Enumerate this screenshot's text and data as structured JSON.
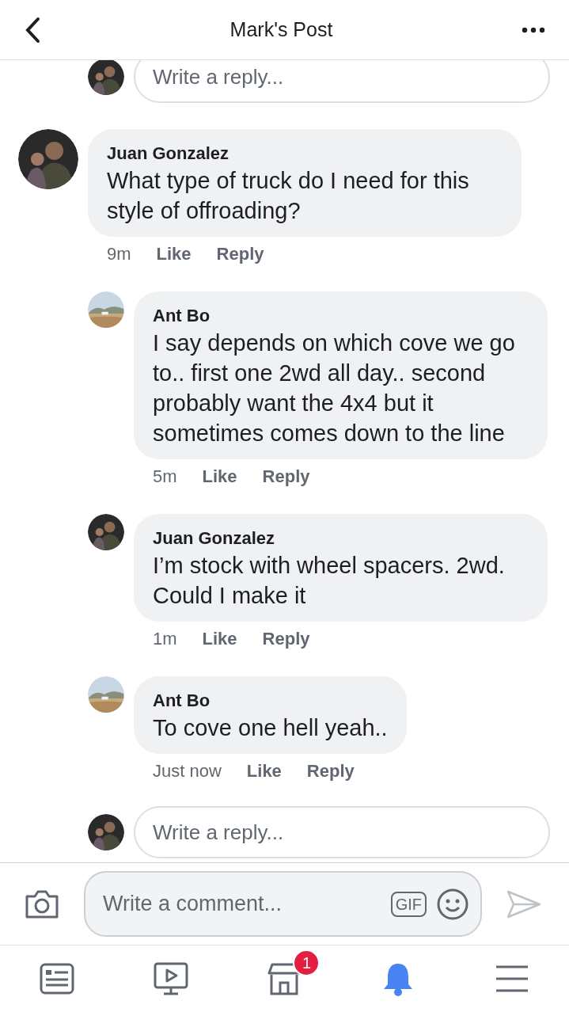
{
  "header": {
    "title": "Mark's Post"
  },
  "top_reply": {
    "placeholder": "Write a reply..."
  },
  "comments": [
    {
      "author": "Juan Gonzalez",
      "kind": "person",
      "text": "What type of truck do I need for this style of offroading?",
      "time": "9m",
      "actions": [
        "Like",
        "Reply"
      ],
      "replies": [
        {
          "author": "Ant Bo",
          "kind": "picture",
          "text": "I say depends on which cove we go to.. first one 2wd all day.. second probably want the 4x4 but it sometimes comes down to the line",
          "time": "5m",
          "actions": [
            "Like",
            "Reply"
          ]
        },
        {
          "author": "Juan Gonzalez",
          "kind": "person",
          "text": "I’m stock with wheel spacers. 2wd. Could I make it",
          "time": "1m",
          "actions": [
            "Like",
            "Reply"
          ]
        },
        {
          "author": "Ant Bo",
          "kind": "picture",
          "text": "To cove one hell yeah..",
          "time": "Just now",
          "actions": [
            "Like",
            "Reply"
          ]
        }
      ],
      "reply_field": {
        "placeholder": "Write a reply..."
      }
    }
  ],
  "composer": {
    "placeholder": "Write a comment...",
    "gif": "GIF"
  },
  "tabs": [
    {
      "kind": "news",
      "selected": false
    },
    {
      "kind": "video",
      "selected": false
    },
    {
      "kind": "market",
      "selected": false,
      "badge": "1"
    },
    {
      "kind": "bell",
      "selected": true
    },
    {
      "kind": "menu",
      "selected": false
    }
  ]
}
